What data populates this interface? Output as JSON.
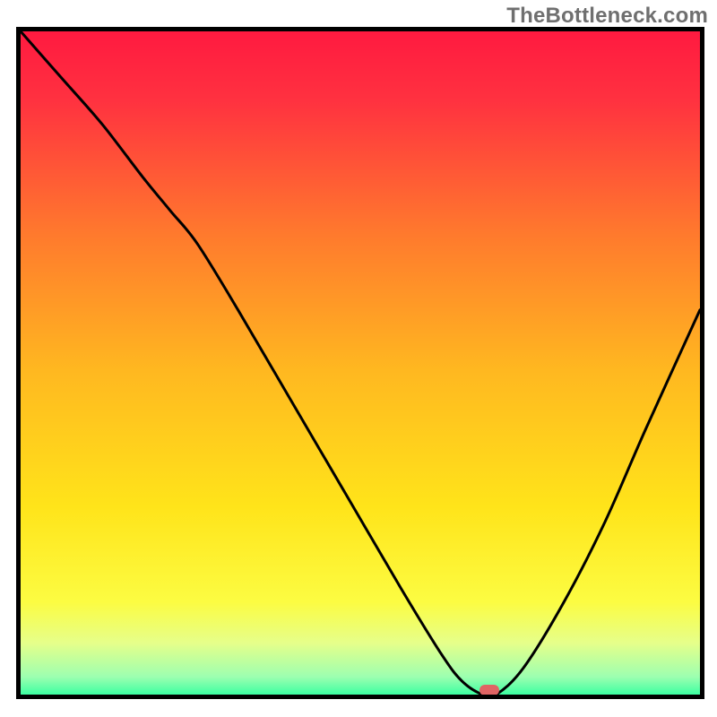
{
  "watermark": "TheBottleneck.com",
  "chart_data": {
    "type": "line",
    "title": "",
    "xlabel": "",
    "ylabel": "",
    "xlim": [
      0,
      100
    ],
    "ylim": [
      0,
      100
    ],
    "grid": false,
    "legend": false,
    "background": {
      "style": "vertical-gradient",
      "stops": [
        {
          "pos": 0.0,
          "color": "#ff1a40"
        },
        {
          "pos": 0.1,
          "color": "#ff3140"
        },
        {
          "pos": 0.3,
          "color": "#ff7a2d"
        },
        {
          "pos": 0.5,
          "color": "#ffb820"
        },
        {
          "pos": 0.7,
          "color": "#ffe41a"
        },
        {
          "pos": 0.84,
          "color": "#fcfc42"
        },
        {
          "pos": 0.9,
          "color": "#e6ff8a"
        },
        {
          "pos": 0.95,
          "color": "#9dffb0"
        },
        {
          "pos": 0.98,
          "color": "#2fffa0"
        },
        {
          "pos": 1.0,
          "color": "#00e68a"
        }
      ]
    },
    "series": [
      {
        "name": "bottleneck-curve",
        "color": "#000000",
        "x": [
          0,
          6,
          12,
          18,
          22,
          26,
          32,
          40,
          48,
          56,
          62,
          65,
          68,
          70,
          74,
          80,
          86,
          92,
          100
        ],
        "y": [
          100,
          93,
          86,
          78,
          73,
          68,
          58,
          44,
          30,
          16,
          6,
          2,
          0,
          0,
          4,
          14,
          26,
          40,
          58
        ]
      }
    ],
    "marker": {
      "name": "optimal-point",
      "x": 69,
      "y": 0.7,
      "color": "#e06464"
    }
  }
}
